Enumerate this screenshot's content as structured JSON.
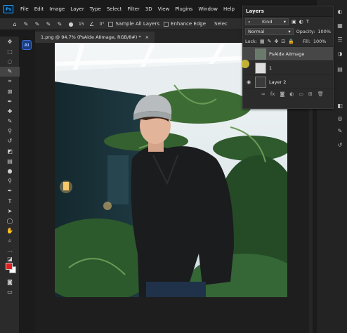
{
  "app": {
    "logo": "Ps"
  },
  "menu": [
    "File",
    "Edit",
    "Image",
    "Layer",
    "Type",
    "Select",
    "Filter",
    "3D",
    "View",
    "Plugins",
    "Window",
    "Help"
  ],
  "options": {
    "size_value": "15",
    "angle_value": "0°",
    "sample_all_layers": "Sample All Layers",
    "enhance_edge": "Enhance Edge",
    "select_subject": "Selec"
  },
  "ai_button": "AI",
  "document": {
    "tab_title": "1.png @ 94.7% (PsAide AIImage, RGB/8#) *",
    "close": "×"
  },
  "layers_panel": {
    "tab": "Layers",
    "filter_kind": "Kind",
    "blend_mode": "Normal",
    "opacity_label": "Opacity:",
    "opacity_value": "100%",
    "lock_label": "Lock:",
    "fill_label": "Fill:",
    "fill_value": "100%",
    "layers": [
      {
        "name": "PsAide AIImage",
        "visible": false,
        "active": true
      },
      {
        "name": "1",
        "visible": false,
        "active": false
      },
      {
        "name": "Layer 2",
        "visible": true,
        "active": false
      }
    ],
    "footer_fx": "fx"
  },
  "colors": {
    "accent": "#31a8ff",
    "foreground_swatch": "#e02020",
    "background_swatch": "#ffffff"
  }
}
